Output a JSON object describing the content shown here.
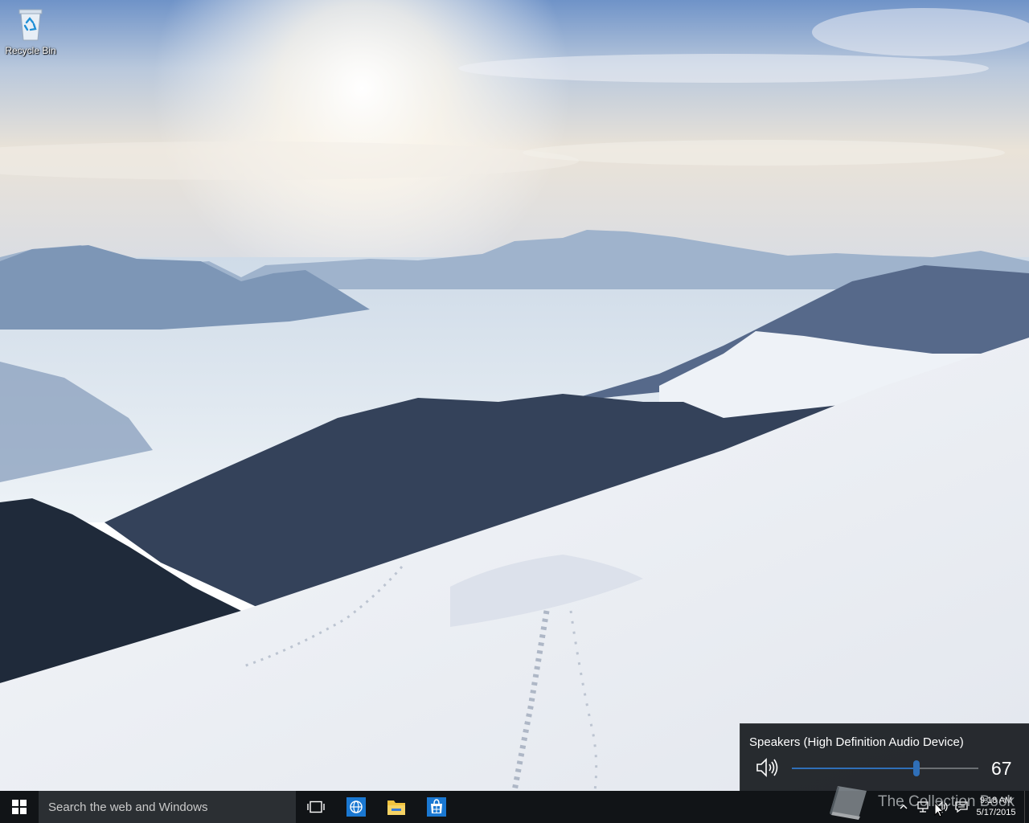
{
  "desktop": {
    "icons": [
      {
        "label": "Recycle Bin",
        "icon": "recycle-bin-icon"
      }
    ]
  },
  "taskbar": {
    "start_icon": "windows-logo-icon",
    "search_placeholder": "Search the web and Windows",
    "apps": [
      {
        "name": "task-view",
        "icon": "task-view-icon"
      },
      {
        "name": "edge",
        "icon": "browser-globe-icon"
      },
      {
        "name": "file-explorer",
        "icon": "folder-icon"
      },
      {
        "name": "store",
        "icon": "store-bag-icon"
      }
    ],
    "tray": {
      "icons": [
        "chevron-up-icon",
        "network-icon",
        "speaker-icon",
        "action-center-icon"
      ],
      "time": "9:18 AM",
      "date": "5/17/2015"
    }
  },
  "volume_flyout": {
    "device": "Speakers (High Definition Audio Device)",
    "level": 67
  },
  "watermark": {
    "text": "The Collection Book"
  },
  "colors": {
    "taskbar": "#111417",
    "search_box": "#2b2f33",
    "flyout_bg": "#1f2226",
    "accent": "#2f6fb8"
  }
}
